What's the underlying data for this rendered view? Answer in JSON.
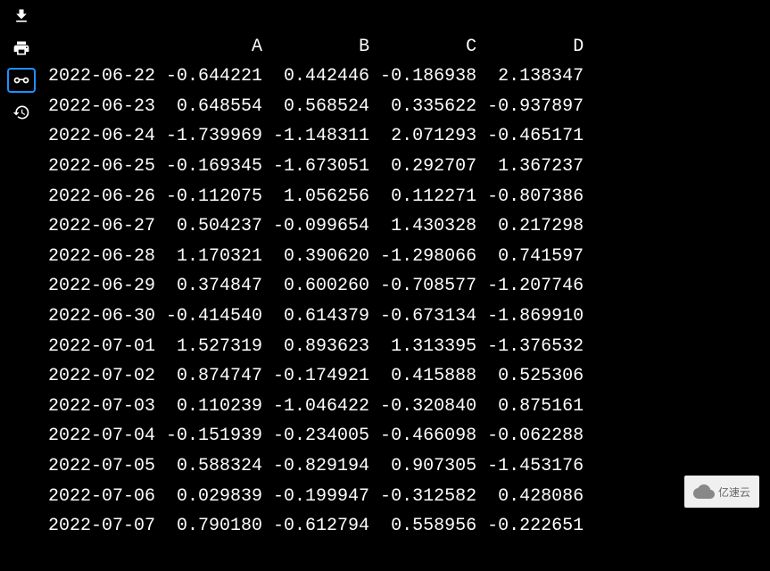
{
  "chart_data": {
    "type": "table",
    "columns": [
      "A",
      "B",
      "C",
      "D"
    ],
    "index": [
      "2022-06-22",
      "2022-06-23",
      "2022-06-24",
      "2022-06-25",
      "2022-06-26",
      "2022-06-27",
      "2022-06-28",
      "2022-06-29",
      "2022-06-30",
      "2022-07-01",
      "2022-07-02",
      "2022-07-03",
      "2022-07-04",
      "2022-07-05",
      "2022-07-06",
      "2022-07-07"
    ],
    "rows": [
      {
        "date": "2022-06-22",
        "A": "-0.644221",
        "B": " 0.442446",
        "C": "-0.186938",
        "D": " 2.138347"
      },
      {
        "date": "2022-06-23",
        "A": " 0.648554",
        "B": " 0.568524",
        "C": " 0.335622",
        "D": "-0.937897"
      },
      {
        "date": "2022-06-24",
        "A": "-1.739969",
        "B": "-1.148311",
        "C": " 2.071293",
        "D": "-0.465171"
      },
      {
        "date": "2022-06-25",
        "A": "-0.169345",
        "B": "-1.673051",
        "C": " 0.292707",
        "D": " 1.367237"
      },
      {
        "date": "2022-06-26",
        "A": "-0.112075",
        "B": " 1.056256",
        "C": " 0.112271",
        "D": "-0.807386"
      },
      {
        "date": "2022-06-27",
        "A": " 0.504237",
        "B": "-0.099654",
        "C": " 1.430328",
        "D": " 0.217298"
      },
      {
        "date": "2022-06-28",
        "A": " 1.170321",
        "B": " 0.390620",
        "C": "-1.298066",
        "D": " 0.741597"
      },
      {
        "date": "2022-06-29",
        "A": " 0.374847",
        "B": " 0.600260",
        "C": "-0.708577",
        "D": "-1.207746"
      },
      {
        "date": "2022-06-30",
        "A": "-0.414540",
        "B": " 0.614379",
        "C": "-0.673134",
        "D": "-1.869910"
      },
      {
        "date": "2022-07-01",
        "A": " 1.527319",
        "B": " 0.893623",
        "C": " 1.313395",
        "D": "-1.376532"
      },
      {
        "date": "2022-07-02",
        "A": " 0.874747",
        "B": "-0.174921",
        "C": " 0.415888",
        "D": " 0.525306"
      },
      {
        "date": "2022-07-03",
        "A": " 0.110239",
        "B": "-1.046422",
        "C": "-0.320840",
        "D": " 0.875161"
      },
      {
        "date": "2022-07-04",
        "A": "-0.151939",
        "B": "-0.234005",
        "C": "-0.466098",
        "D": "-0.062288"
      },
      {
        "date": "2022-07-05",
        "A": " 0.588324",
        "B": "-0.829194",
        "C": " 0.907305",
        "D": "-1.453176"
      },
      {
        "date": "2022-07-06",
        "A": " 0.029839",
        "B": "-0.199947",
        "C": "-0.312582",
        "D": " 0.428086"
      },
      {
        "date": "2022-07-07",
        "A": " 0.790180",
        "B": "-0.612794",
        "C": " 0.558956",
        "D": "-0.222651"
      }
    ]
  },
  "header": {
    "A": "A",
    "B": "B",
    "C": "C",
    "D": "D"
  },
  "watermark": {
    "text": "亿速云"
  }
}
